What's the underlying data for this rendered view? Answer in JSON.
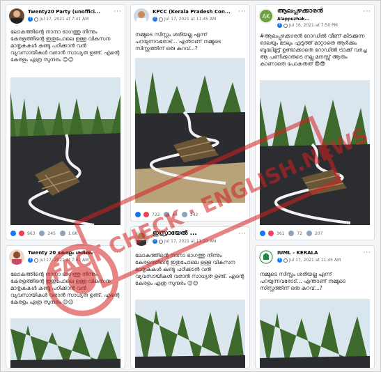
{
  "posts": [
    {
      "author": "Twenty20 Party (unoffici...",
      "time": "Jul 17, 2021 at 7:41 AM",
      "text": "ലോകത്തിന്റെ നാനാ ഭാഗത്തു നിന്നും കേരളത്തിന്റെ ഇതുപോലെ ഉള്ള വികസന മാതൃകകൾ കണ്ടു പഠിക്കാൻ വൻ വ്യവസായികൾ വരാൻ സാധ്യത ഉണ്ട്. എന്റെ കേരളം എത്ര സുന്ദരം 😊😊",
      "likes": "963",
      "comments": "245",
      "shares": "1.6K"
    },
    {
      "author": "KPCC (Kerala Pradesh Con...",
      "time": "Jul 17, 2021 at 11:45 AM",
      "text": "നമ്മുടെ സിസ്റ്റം ശരിയല്ല എന്ന് പറയുന്നവരോട്... എന്താണ് നമ്മുടെ സിസ്റ്റത്തിന് ഒരു കുറവ്...?",
      "likes": "722",
      "comments": "44",
      "shares": "242"
    },
    {
      "author": "ആലപ്പുഴക്കാരൻ",
      "subname": "Alappuzhak...",
      "time": "Jul 16, 2021 at 7:50 PM",
      "text": "#ആലപ്പുഴക്കാരൻ റോഡിൽ വീണ് കിടക്കുന്ന ഓലയും മടലും എടുത്ത് മാറ്റാതെ ആർക്കും ബുദ്ധിമുട്ട് ഉണ്ടാക്കാതെ റോഡിൽ ട്രാക്ക് വരച്ച ആ പണിക്കാരുടെ നല്ല മനസ്സ് ആരും കാണാതെ പോകരുത് 😎😎",
      "likes": "361",
      "comments": "72",
      "shares": "207"
    },
    {
      "author": "Twenty 20 കേരളം ശരിക്കും",
      "time": "Jul 17, 2021 at 7:42 AM",
      "text": "ലോകത്തിന്റെ നാനാ ഭാഗത്തു നിന്നും കേരളത്തിന്റെ ഇതുപോലെ ഉള്ള വികസന മാതൃകകൾ കണ്ടു പഠിക്കാൻ വൻ വ്യവസായികൾ വരാൻ സാധ്യത ഉണ്ട്. എന്റെ കേരളം എത്ര സുന്ദരം 😊😊"
    },
    {
      "author": "ഇസ്രായേൽ ...",
      "time": "Jul 17, 2021 at 11:20 AM",
      "text": "ലോകത്തിന്റെ നാനാ ഭാഗത്തു നിന്നും കേരളത്തിന്റെ ഇതുപോലെ ഉള്ള വികസന മാതൃകകൾ കണ്ടു പഠിക്കാൻ വൻ വ്യവസായികൾ വരാൻ സാധ്യത ഉണ്ട്. എന്റെ കേരളം എത്ര സുന്ദരം 😊😊"
    },
    {
      "author": "IUML - KERALA",
      "time": "Jul 17, 2021 at 11:45 AM",
      "text": "നമ്മുടെ സിസ്റ്റം ശരിയല്ല എന്ന് പറയുന്നവരോട്... എന്താണ് നമ്മുടെ സിസ്റ്റത്തിന് ഒരു കുറവ്...?"
    }
  ],
  "watermark": "FACT CHECK · ENGLISH.NEWS",
  "colors": {
    "accent": "#1877f2",
    "watermark": "#d42020",
    "love": "#f33e58",
    "like": "#1877f2"
  },
  "icons": {
    "menu": "more-dots-icon",
    "meta": "facebook-icon",
    "privacy": "globe-icon"
  }
}
